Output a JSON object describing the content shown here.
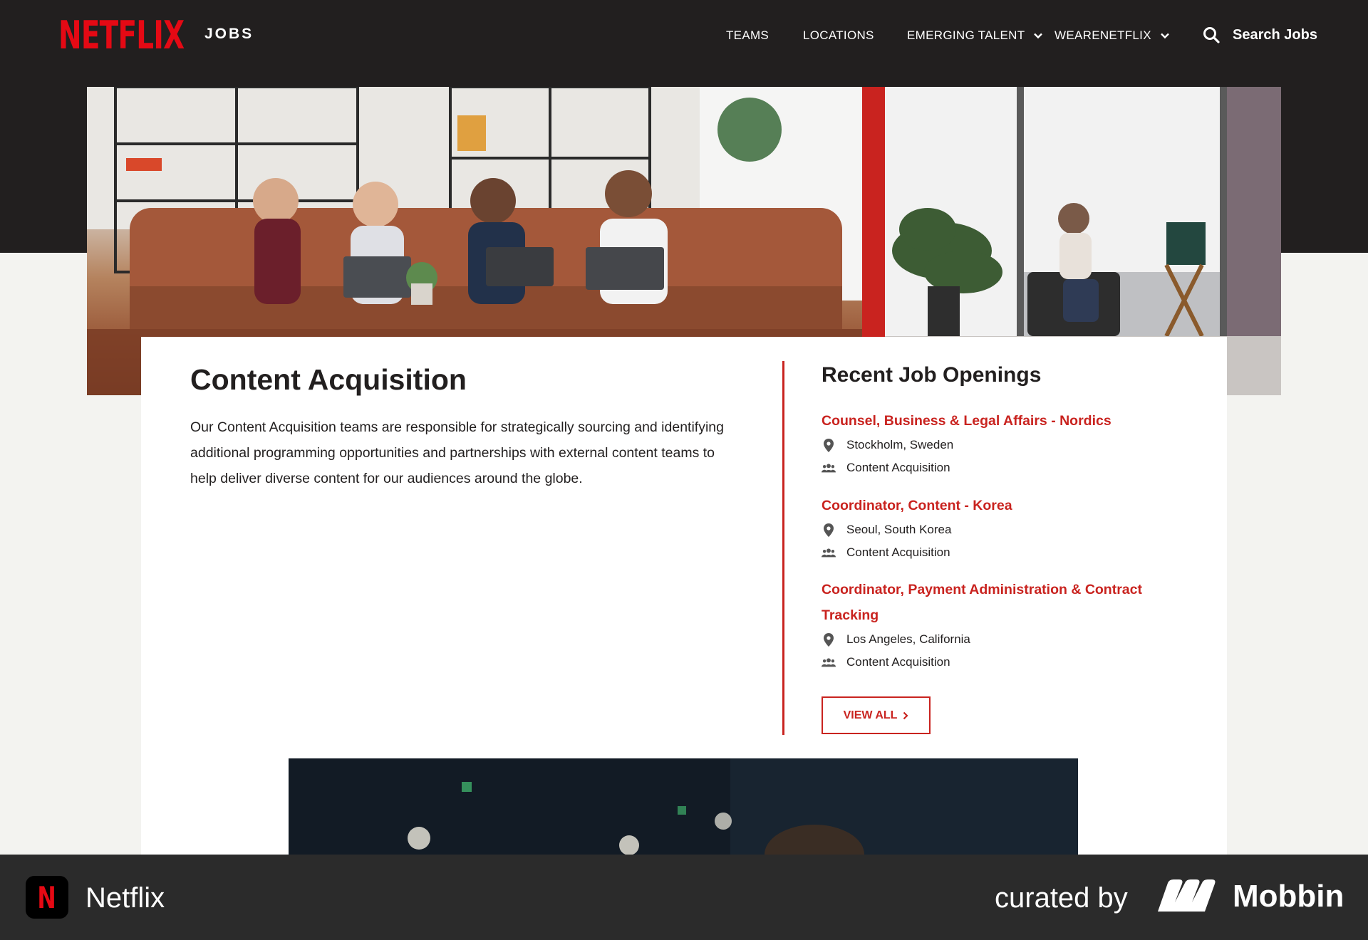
{
  "header": {
    "logo": "NETFLIX",
    "logo_suffix": "JOBS",
    "nav": [
      {
        "label": "TEAMS"
      },
      {
        "label": "LOCATIONS"
      },
      {
        "label": "EMERGING TALENT"
      },
      {
        "label": "WEARENETFLIX"
      }
    ],
    "search_label": "Search Jobs"
  },
  "main": {
    "title": "Content Acquisition",
    "description": "Our Content Acquisition teams are responsible for strategically sourcing and identifying additional programming opportunities and partnerships with external content teams to help deliver diverse content for our audiences around the globe."
  },
  "recent": {
    "title": "Recent Job Openings",
    "jobs": [
      {
        "title": "Counsel, Business & Legal Affairs - Nordics",
        "location": "Stockholm, Sweden",
        "team": "Content Acquisition"
      },
      {
        "title": "Coordinator, Content - Korea",
        "location": "Seoul, South Korea",
        "team": "Content Acquisition"
      },
      {
        "title": "Coordinator, Payment Administration & Contract Tracking",
        "location": "Los Angeles, California",
        "team": "Content Acquisition"
      }
    ],
    "view_all": "VIEW ALL"
  },
  "footer": {
    "app_name": "Netflix",
    "app_icon_letter": "N",
    "curated_by": "curated by",
    "brand": "Mobbin"
  },
  "colors": {
    "brand_red": "#e50914",
    "accent_red": "#c9231f",
    "header_bg": "#221f1f",
    "bottom_bar_bg": "#2b2b2b"
  }
}
